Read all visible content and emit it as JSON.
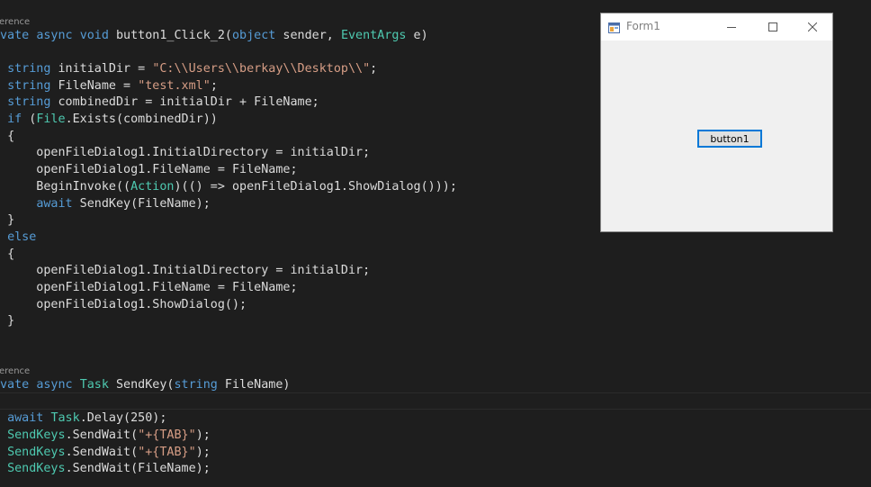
{
  "code": {
    "codelens": [
      "erence",
      "erence"
    ],
    "method1": {
      "modifier": "vate",
      "async": "async",
      "void": "void",
      "name": "button1_Click_2(",
      "object": "object",
      "sender": " sender, ",
      "eventargs": "EventArgs",
      "e": " e)"
    },
    "l1": {
      "kw": "string",
      "rest": " initialDir = ",
      "str": "\"C:\\\\Users\\\\berkay\\\\Desktop\\\\\"",
      "end": ";"
    },
    "l2": {
      "kw": "string",
      "rest": " FileName = ",
      "str": "\"test.xml\"",
      "end": ";"
    },
    "l3": {
      "kw": "string",
      "rest": " combinedDir = initialDir + FileName;"
    },
    "l4": {
      "kw": "if",
      "p1": " (",
      "type": "File",
      "rest": ".Exists(combinedDir))"
    },
    "open_brace": "{",
    "close_brace": "}",
    "l5": "    openFileDialog1.InitialDirectory = initialDir;",
    "l6": "    openFileDialog1.FileName = FileName;",
    "l7": {
      "a": "    BeginInvoke((",
      "type": "Action",
      "b": ")(() => openFileDialog1.ShowDialog()));"
    },
    "l8": {
      "indent": "    ",
      "kw": "await",
      "rest": " SendKey(FileName);"
    },
    "else": "else",
    "l9": "    openFileDialog1.InitialDirectory = initialDir;",
    "l10": "    openFileDialog1.FileName = FileName;",
    "l11": "    openFileDialog1.ShowDialog();",
    "method2": {
      "modifier": "vate",
      "async": "async",
      "task": "Task",
      "name": " SendKey(",
      "string": "string",
      "rest": " FileName)"
    },
    "m1": {
      "kw": "await",
      "sp": " ",
      "type": "Task",
      "rest": ".Delay(250);"
    },
    "m2": {
      "type": "SendKeys",
      "a": ".SendWait(",
      "str": "\"+{TAB}\"",
      "b": ");"
    },
    "m3": {
      "type": "SendKeys",
      "a": ".SendWait(",
      "str": "\"+{TAB}\"",
      "b": ");"
    },
    "m4": {
      "type": "SendKeys",
      "a": ".SendWait(FileName);"
    }
  },
  "form": {
    "title": "Form1",
    "button_label": "button1"
  },
  "colors": {
    "editor_bg": "#1e1e1e",
    "keyword": "#569cd6",
    "type": "#4ec9b0",
    "string": "#d69d85",
    "plain": "#dcdcdc",
    "form_bg": "#f0f0f0",
    "button_border": "#0078d7"
  }
}
